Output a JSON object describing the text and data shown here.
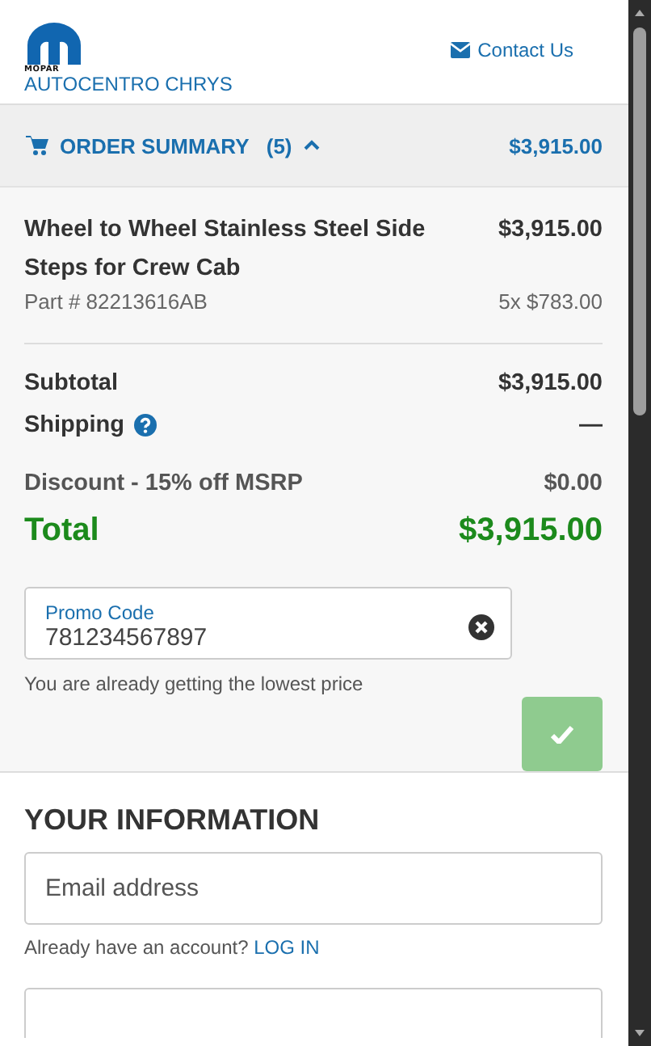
{
  "header": {
    "logo_text": "MOPAR",
    "store_name": "AUTOCENTRO CHRYS",
    "contact_link": "Contact Us"
  },
  "order_summary": {
    "label": "ORDER SUMMARY",
    "count": "(5)",
    "expanded": true,
    "total": "$3,915.00",
    "items": [
      {
        "name": "Wheel to Wheel Stainless Steel Side Steps for Crew Cab",
        "price": "$3,915.00",
        "part": "Part # 82213616AB",
        "quantity_price": "5x $783.00"
      }
    ],
    "lines": [
      {
        "kind": "plain",
        "label": "Subtotal",
        "value": "$3,915.00"
      },
      {
        "kind": "help",
        "label": "Shipping",
        "value": "—"
      },
      {
        "kind": "discount",
        "label": "Discount - 15% off MSRP",
        "value": "$0.00"
      },
      {
        "kind": "total",
        "label": "Total",
        "value": "$3,915.00"
      }
    ],
    "promo": {
      "label": "Promo Code",
      "value": "781234567897",
      "message": "You are already getting the lowest price"
    }
  },
  "your_information": {
    "heading": "YOUR INFORMATION",
    "email": {
      "placeholder": "Email address"
    },
    "account_prompt": "Already have an account?",
    "login_link": "LOG IN"
  }
}
